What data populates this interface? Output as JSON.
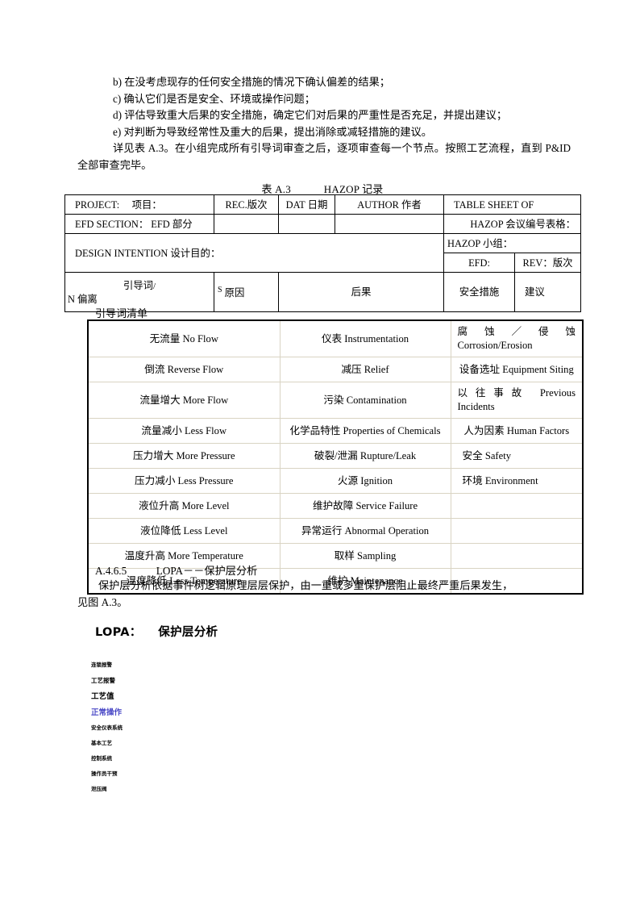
{
  "intro": {
    "items": [
      "b) 在没考虑现存的任何安全措施的情况下确认偏差的结果；",
      "c) 确认它们是否是安全、环境或操作问题；",
      "d) 评估导致重大后果的安全措施，确定它们对后果的严重性是否充足，并提出建议；",
      "e) 对判断为导致经常性及重大的后果，提出消除或减轻措施的建议。"
    ],
    "paragraph": "详见表 A.3。在小组完成所有引导词审查之后，逐项审查每一个节点。按照工艺流程，直到 P&ID 全部审查完毕。"
  },
  "hazop_caption": {
    "label": "表 A.3",
    "title": "HAZOP 记录"
  },
  "hazop_table": {
    "r1": {
      "project": "PROJECT:　 项目：",
      "rec": "REC.版次",
      "dat": "DAT 日期",
      "author": "AUTHOR 作者",
      "table_sheet_of": "TABLE  SHEET  OF"
    },
    "r2": {
      "efd_section": "EFD SECTION：  EFD 部分",
      "rec": "",
      "dat": "",
      "author": "",
      "hazop_meeting": "HAZOP 会议编号表格："
    },
    "r3": {
      "design_intention": "DESIGN INTENTION 设计目的：",
      "hazop_team": "HAZOP 小组："
    },
    "r4": {
      "efd": "EFD:",
      "rev": "REV：版次"
    },
    "r5": {
      "guideword_l1": "引导词",
      "guideword_slash": "/",
      "guideword_l2": "N 偏离",
      "cause_sup": "S",
      "cause": "原因",
      "consequence": "后果",
      "safeguard": "安全措施",
      "recommendation": "建议"
    }
  },
  "guide_list_label": "引导词清单",
  "guide_table": {
    "rows": [
      {
        "c1": "无流量 No Flow",
        "c2": "仪表 Instrumentation",
        "c3": "腐蚀／侵蚀Corrosion/Erosion",
        "c3_two_line": true
      },
      {
        "c1": "倒流 Reverse Flow",
        "c2": "减压 Relief",
        "c3": "设备选址 Equipment Siting",
        "c3_two_line": false
      },
      {
        "c1": "流量增大 More Flow",
        "c2": "污染 Contamination",
        "c3": "以往事故 Previous Incidents",
        "c3_two_line": true
      },
      {
        "c1": "流量减小 Less Flow",
        "c2": "化学品特性 Properties of Chemicals",
        "c3": "人为因素 Human Factors",
        "c3_two_line": false
      },
      {
        "c1": "压力增大 More Pressure",
        "c2": "破裂/泄漏 Rupture/Leak",
        "c3": "安全 Safety",
        "c3_two_line": false
      },
      {
        "c1": "压力减小 Less Pressure",
        "c2": "火源 Ignition",
        "c3": "环境 Environment",
        "c3_two_line": false
      },
      {
        "c1": "液位升高 More Level",
        "c2": "维护故障 Service Failure",
        "c3": "",
        "c3_two_line": false
      },
      {
        "c1": "液位降低 Less Level",
        "c2": "异常运行 Abnormal Operation",
        "c3": "",
        "c3_two_line": false
      },
      {
        "c1": "温度升高 More Temperature",
        "c2": "取样 Sampling",
        "c3": "",
        "c3_two_line": false
      },
      {
        "c1": "温度降低 Less Temperature",
        "c2": "维护 Maintenance",
        "c3": "",
        "c3_two_line": false
      }
    ]
  },
  "lopa": {
    "clause_number": "A.4.6.5",
    "clause_title": "LOPA－－保护层分析",
    "body_line1": "保护层分析依据事件树逻辑原理层层保护，由一重或多重保护层阻止最终严重后果发生，",
    "body_line2": "见图  A.3。",
    "figure_title_en": "LOPA：",
    "figure_title_cn": "保护层分析",
    "layers": [
      {
        "text": "连锁报警",
        "size": "s6",
        "color": "#000000"
      },
      {
        "text": "工艺报警",
        "size": "s7",
        "color": "#000000"
      },
      {
        "text": "工艺值",
        "size": "s9",
        "color": "#000000"
      },
      {
        "text": "正常操作",
        "size": "s9b",
        "color": "#4a49c6"
      },
      {
        "text": "安全仪表系统",
        "size": "s6",
        "color": "#000000"
      },
      {
        "text": "基本工艺",
        "size": "s6",
        "color": "#000000"
      },
      {
        "text": "控制系统",
        "size": "s6",
        "color": "#000000"
      },
      {
        "text": "操作员干预",
        "size": "s6",
        "color": "#000000"
      },
      {
        "text": "泄压阀",
        "size": "s6",
        "color": "#000000"
      }
    ]
  }
}
